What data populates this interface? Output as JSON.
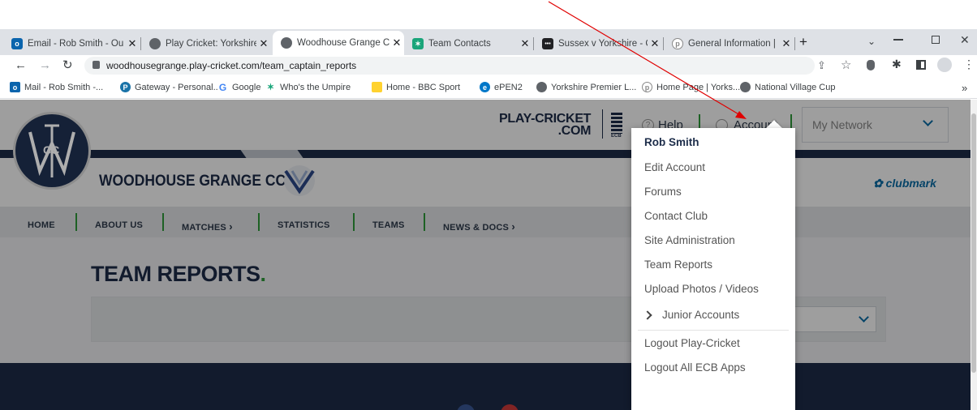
{
  "browser": {
    "tabs": [
      {
        "title": "Email - Rob Smith - Ou",
        "icon": "outlook-icon",
        "color": "#0a64ad"
      },
      {
        "title": "Play Cricket: Yorkshire",
        "icon": "globe-icon",
        "color": "#5f6368"
      },
      {
        "title": "Woodhouse Grange C",
        "icon": "globe-icon",
        "color": "#5f6368"
      },
      {
        "title": "Team Contacts",
        "icon": "bird-icon",
        "color": "#1aa57a"
      },
      {
        "title": "Sussex v Yorkshire - C",
        "icon": "dots-icon",
        "color": "#202124"
      },
      {
        "title": "General Information |",
        "icon": "feather-icon",
        "color": "#888"
      }
    ],
    "new_tab": "+",
    "url": "woodhousegrange.play-cricket.com/team_captain_reports",
    "bookmarks": [
      {
        "label": "Mail - Rob Smith -...",
        "icon": "outlook-icon",
        "color": "#0a64ad"
      },
      {
        "label": "Gateway - Personal...",
        "icon": "pin-icon",
        "color": "#1a73a8"
      },
      {
        "label": "Google",
        "icon": "google-icon",
        "color": "#4285f4"
      },
      {
        "label": "Who's the Umpire",
        "icon": "bird-icon",
        "color": "#1aa57a"
      },
      {
        "label": "Home - BBC Sport",
        "icon": "bbc-icon",
        "color": "#ffd230"
      },
      {
        "label": "ePEN2",
        "icon": "epen-icon",
        "color": "#0077c8"
      },
      {
        "label": "Yorkshire Premier L...",
        "icon": "globe-icon",
        "color": "#5f6368"
      },
      {
        "label": "Home Page | Yorks...",
        "icon": "feather-icon",
        "color": "#888"
      },
      {
        "label": "National Village Cup",
        "icon": "globe-icon",
        "color": "#5f6368"
      }
    ],
    "more_bookmarks": "»"
  },
  "header": {
    "brand_line1": "PLAY-CRICKET",
    "brand_line2": ".COM",
    "ecb": "ECB",
    "help": "Help",
    "account": "Account",
    "network": "My Network",
    "club_name": "WOODHOUSE GRANGE CC",
    "clubmark": "clubmark",
    "crest_letters": "CC"
  },
  "nav": [
    "HOME",
    "ABOUT US",
    "MATCHES",
    "STATISTICS",
    "TEAMS",
    "NEWS & DOCS"
  ],
  "page_title": "TEAM REPORTS",
  "menu": {
    "user": "Rob Smith",
    "items": [
      "Edit Account",
      "Forums",
      "Contact Club",
      "Site Administration",
      "Team Reports",
      "Upload Photos / Videos",
      "Junior Accounts",
      "Logout Play-Cricket",
      "Logout All ECB Apps"
    ]
  },
  "colors": {
    "navy": "#1d2d4a",
    "green": "#2f9d3b",
    "annotation": "#e00000",
    "accent": "#0b6ea8"
  }
}
